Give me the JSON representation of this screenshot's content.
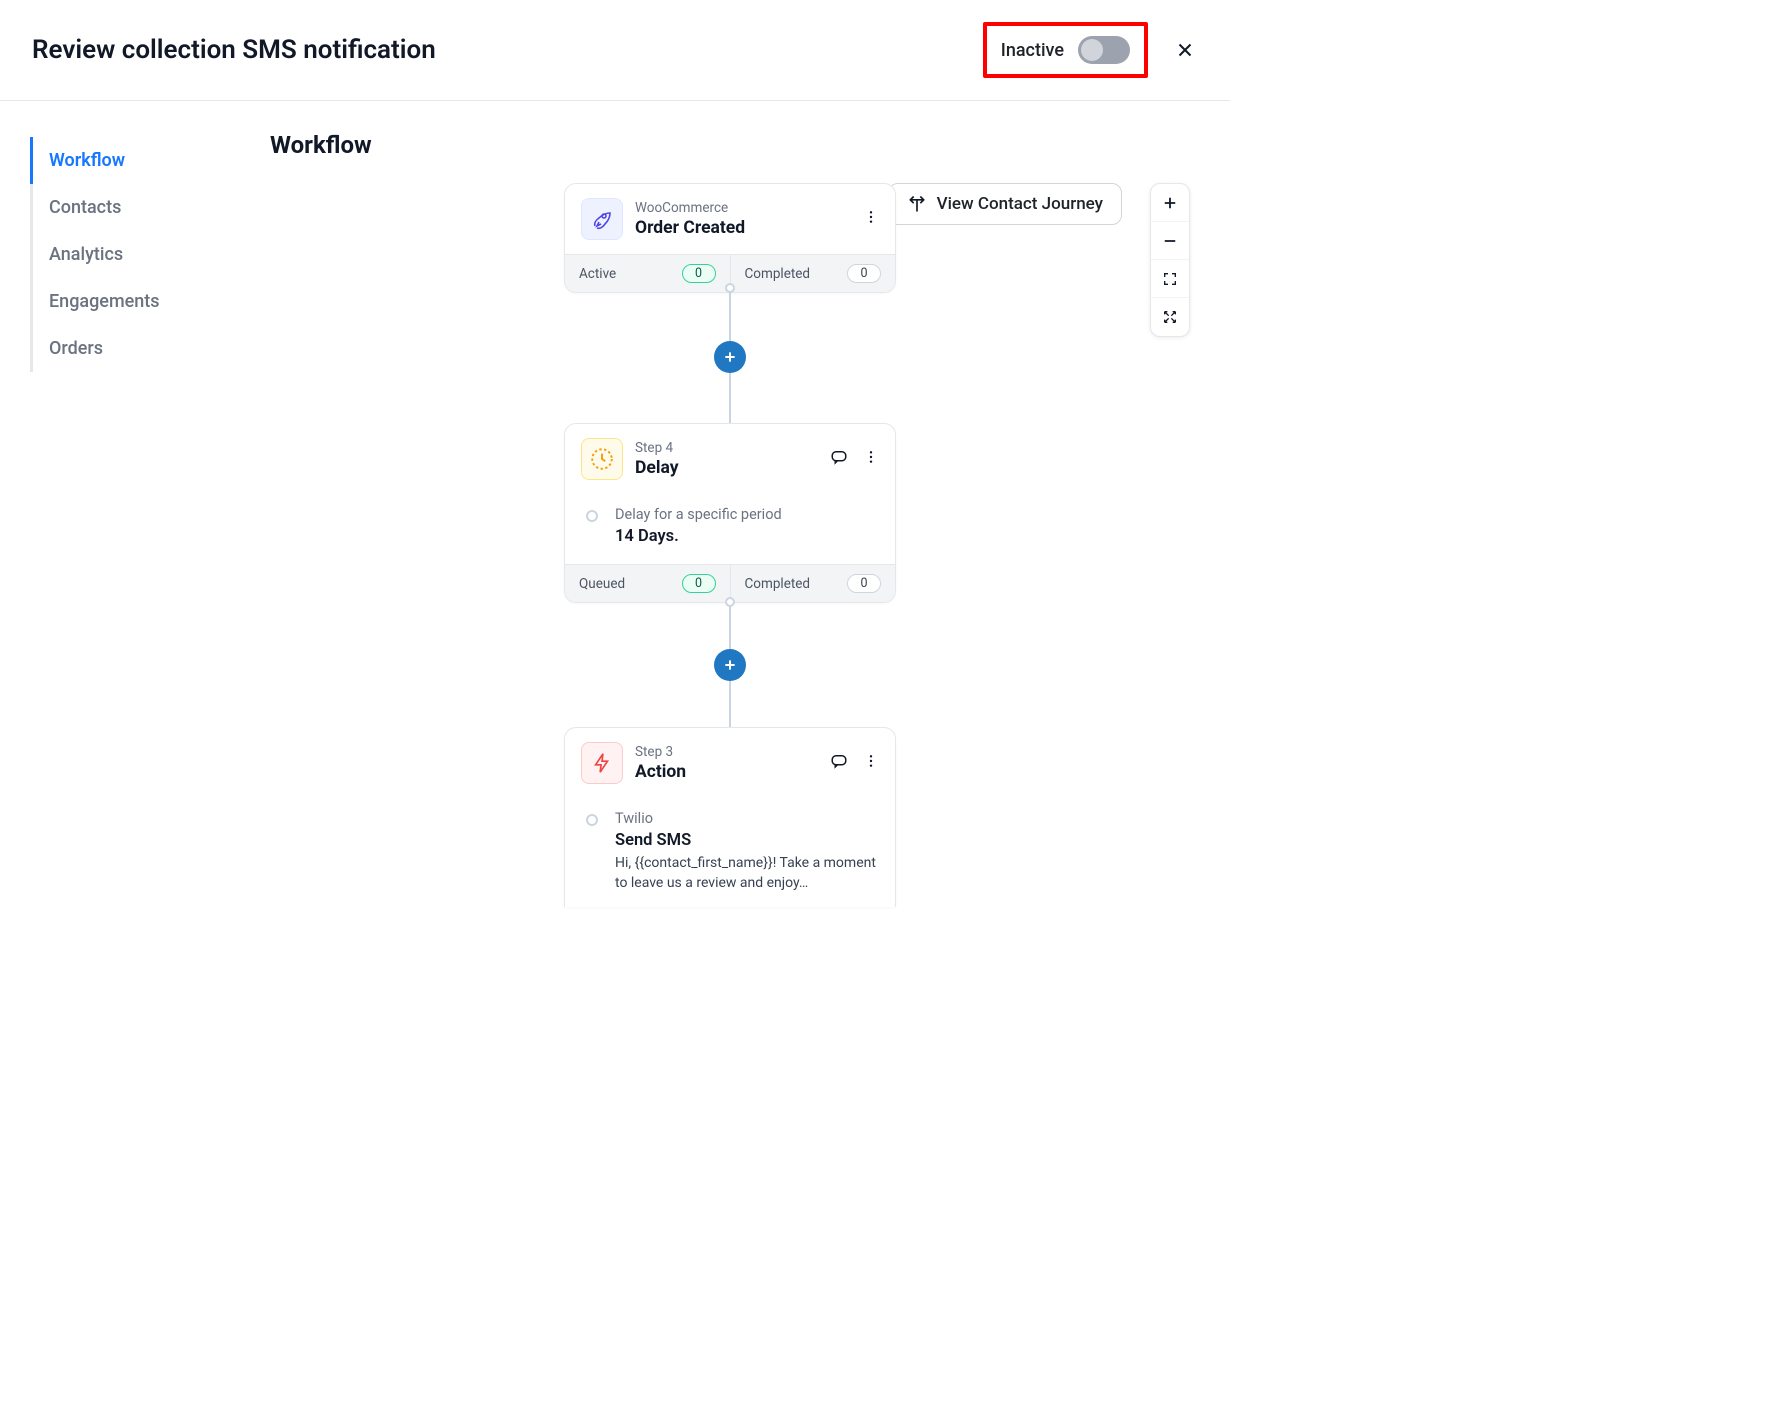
{
  "header": {
    "title": "Review collection SMS notification",
    "status_label": "Inactive",
    "toggle_on": false
  },
  "sidebar": {
    "items": [
      {
        "label": "Workflow",
        "active": true
      },
      {
        "label": "Contacts",
        "active": false
      },
      {
        "label": "Analytics",
        "active": false
      },
      {
        "label": "Engagements",
        "active": false
      },
      {
        "label": "Orders",
        "active": false
      }
    ]
  },
  "main": {
    "page_title": "Workflow",
    "journey_button": "View Contact Journey"
  },
  "nodes": {
    "trigger": {
      "subtitle": "WooCommerce",
      "title": "Order Created",
      "stats": {
        "left_label": "Active",
        "left_value": "0",
        "right_label": "Completed",
        "right_value": "0"
      }
    },
    "delay": {
      "subtitle": "Step 4",
      "title": "Delay",
      "body_line1": "Delay for a specific period",
      "body_line2": "14 Days.",
      "stats": {
        "left_label": "Queued",
        "left_value": "0",
        "right_label": "Completed",
        "right_value": "0"
      }
    },
    "action": {
      "subtitle": "Step 3",
      "title": "Action",
      "provider": "Twilio",
      "action_title": "Send SMS",
      "message": "Hi, {{contact_first_name}}! Take a moment to leave us a review and enjoy…"
    }
  },
  "highlight": {
    "color": "#ff0000"
  }
}
